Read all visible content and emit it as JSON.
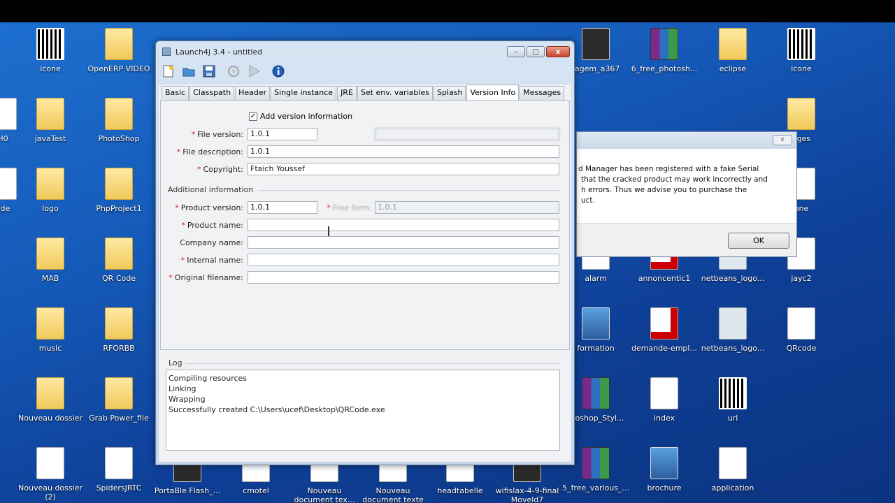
{
  "desktop_icons": [
    {
      "label": "icone",
      "type": "qr"
    },
    {
      "label": "OpenERP VIDEO",
      "type": "folder"
    },
    {
      "label": "javaTest",
      "type": "folder"
    },
    {
      "label": "PhotoShop",
      "type": "folder"
    },
    {
      "label": "logo",
      "type": "folder"
    },
    {
      "label": "PhpProject1",
      "type": "folder"
    },
    {
      "label": "MAB",
      "type": "folder"
    },
    {
      "label": "QR Code",
      "type": "folder"
    },
    {
      "label": "music",
      "type": "folder"
    },
    {
      "label": "RFORBB",
      "type": "folder"
    },
    {
      "label": "Nouveau dossier",
      "type": "folder"
    },
    {
      "label": "Grab Power_file",
      "type": "folder"
    },
    {
      "label": "Nouveau dossier (2)",
      "type": "doc"
    },
    {
      "label": "SpidersJRTC",
      "type": "doc"
    },
    {
      "label": "PortaBle Flash_...",
      "type": "dark"
    },
    {
      "label": "cmotel",
      "type": "doc"
    },
    {
      "label": "Nouveau document tex...",
      "type": "doc"
    },
    {
      "label": "Nouveau document texte",
      "type": "doc"
    },
    {
      "label": "headtabelle",
      "type": "doc"
    },
    {
      "label": "wifislax-4-9-final Moveld7",
      "type": "dark"
    },
    {
      "label": "5_free_various_...",
      "type": "rar"
    },
    {
      "label": "brochure",
      "type": "img"
    },
    {
      "label": "application",
      "type": "doc"
    },
    {
      "label": "tagem_a367",
      "type": "dark"
    },
    {
      "label": "6_free_photosh...",
      "type": "rar"
    },
    {
      "label": "eclipse",
      "type": "folder"
    },
    {
      "label": "icone",
      "type": "qr"
    },
    {
      "label": "alarm",
      "type": "doc"
    },
    {
      "label": "annoncentic1",
      "type": "pdf"
    },
    {
      "label": "netbeans_logo...",
      "type": "gray"
    },
    {
      "label": "jayc2",
      "type": "doc"
    },
    {
      "label": "formation",
      "type": "img"
    },
    {
      "label": "demande-empl...",
      "type": "pdf"
    },
    {
      "label": "netbeans_logo...",
      "type": "gray"
    },
    {
      "label": "QRcode",
      "type": "doc"
    },
    {
      "label": "otoshop_Styl...",
      "type": "rar"
    },
    {
      "label": "index",
      "type": "doc"
    },
    {
      "label": "url",
      "type": "qr"
    },
    {
      "label": "ages",
      "type": "folder"
    },
    {
      "label": "one",
      "type": "doc"
    },
    {
      "label": "H0",
      "type": "doc"
    },
    {
      "label": "ode",
      "type": "doc"
    }
  ],
  "window": {
    "title": "Launch4j 3.4 - untitled",
    "minimize": "–",
    "maximize": "□",
    "close": "x"
  },
  "toolbar_icons": [
    "new-icon",
    "open-icon",
    "save-icon",
    "build-icon",
    "run-icon",
    "about-icon"
  ],
  "tabs": [
    "Basic",
    "Classpath",
    "Header",
    "Single instance",
    "JRE",
    "Set env. variables",
    "Splash",
    "Version Info",
    "Messages"
  ],
  "active_tab": "Version Info",
  "version_info": {
    "add_version_label": "Add version information",
    "file_version_label": "File version:",
    "file_version": "1.0.1",
    "file_description_label": "File description:",
    "file_description": "1.0.1",
    "copyright_label": "Copyright:",
    "copyright": "Ftaich Youssef",
    "additional_title": "Additional information",
    "product_version_label": "Product version:",
    "product_version": "1.0.1",
    "free_form_label": "Free form:",
    "free_form": "1.0.1",
    "product_name_label": "Product name:",
    "product_name": "",
    "company_name_label": "Company name:",
    "company_name": "",
    "internal_name_label": "Internal name:",
    "internal_name": "",
    "original_filename_label": "Original filename:",
    "original_filename": ""
  },
  "log": {
    "title": "Log",
    "lines": [
      "Compiling resources",
      "Linking",
      "Wrapping",
      "Successfully created C:\\Users\\ucef\\Desktop\\QRCode.exe"
    ]
  },
  "dialog": {
    "close": "x",
    "lines": [
      "d Manager has been registered with a fake Serial",
      "that the cracked product may work incorrectly and",
      "h errors. Thus we advise you to purchase the",
      "uct."
    ],
    "ok_label": "OK"
  }
}
